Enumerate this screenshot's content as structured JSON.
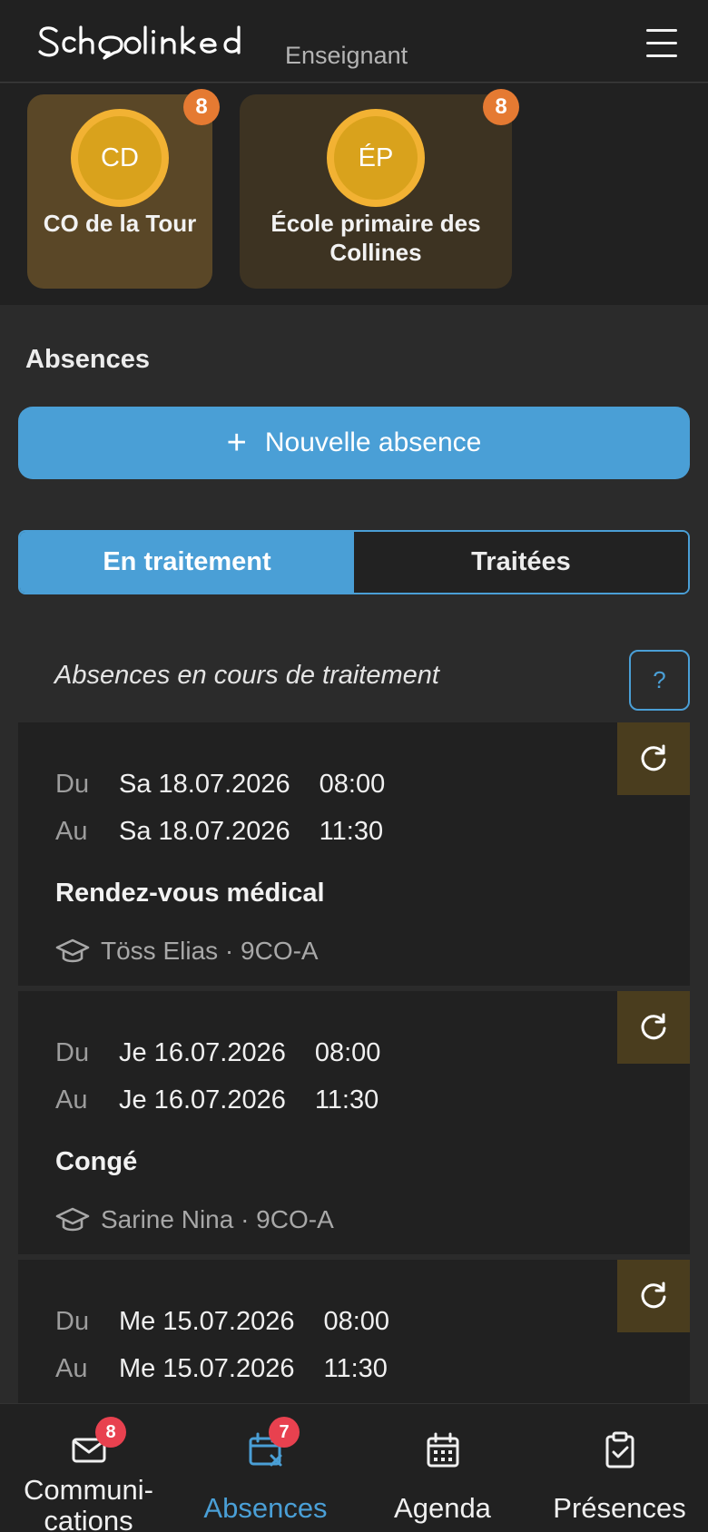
{
  "header": {
    "logo_text": "Schoolinked",
    "role": "Enseignant",
    "menu_icon": "hamburger-icon"
  },
  "schools": [
    {
      "initials": "CD",
      "name": "CO de la Tour",
      "badge": "8",
      "selected": true
    },
    {
      "initials": "ÉP",
      "name": "École primaire des Collines",
      "badge": "8",
      "selected": false
    }
  ],
  "section_title": "Absences",
  "new_button": {
    "icon": "plus-icon",
    "label": "Nouvelle absence"
  },
  "tabs": [
    {
      "label": "En traitement",
      "active": true
    },
    {
      "label": "Traitées",
      "active": false
    }
  ],
  "subtitle": "Absences en cours de traitement",
  "help_label": "?",
  "labels": {
    "from": "Du",
    "to": "Au"
  },
  "absences": [
    {
      "from_date": "Sa 18.07.2026",
      "from_time": "08:00",
      "to_date": "Sa 18.07.2026",
      "to_time": "11:30",
      "reason": "Rendez-vous médical",
      "student": "Töss Elias · 9CO-A"
    },
    {
      "from_date": "Je 16.07.2026",
      "from_time": "08:00",
      "to_date": "Je 16.07.2026",
      "to_time": "11:30",
      "reason": "Congé",
      "student": "Sarine Nina · 9CO-A"
    },
    {
      "from_date": "Me 15.07.2026",
      "from_time": "08:00",
      "to_date": "Me 15.07.2026",
      "to_time": "11:30",
      "reason": "",
      "student": ""
    }
  ],
  "nav": [
    {
      "label_line1": "Communi-",
      "label_line2": "cations",
      "icon": "mail-icon",
      "badge": "8",
      "active": false
    },
    {
      "label_line1": "Absences",
      "icon": "calendar-x-icon",
      "badge": "7",
      "active": true
    },
    {
      "label_line1": "Agenda",
      "icon": "calendar-icon",
      "active": false
    },
    {
      "label_line1": "Présences",
      "icon": "clipboard-check-icon",
      "active": false
    }
  ],
  "colors": {
    "accent": "#4a9fd6",
    "background": "#2b2b2b",
    "card": "#212121",
    "school_badge": "#e57a32",
    "nav_badge": "#e8414f",
    "avatar": "#d9a21c"
  }
}
